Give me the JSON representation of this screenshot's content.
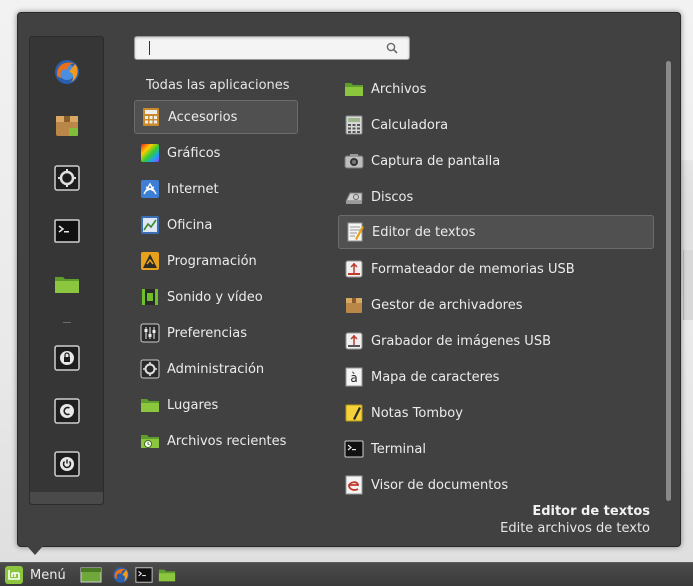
{
  "search": {
    "value": "",
    "placeholder": ""
  },
  "categories_header": "Todas las aplicaciones",
  "categories": [
    {
      "label": "Accesorios",
      "icon": "accessories-icon",
      "active": true
    },
    {
      "label": "Gráficos",
      "icon": "graphics-icon"
    },
    {
      "label": "Internet",
      "icon": "internet-icon"
    },
    {
      "label": "Oficina",
      "icon": "office-icon"
    },
    {
      "label": "Programación",
      "icon": "programming-icon"
    },
    {
      "label": "Sonido y vídeo",
      "icon": "multimedia-icon"
    },
    {
      "label": "Preferencias",
      "icon": "preferences-icon"
    },
    {
      "label": "Administración",
      "icon": "administration-icon"
    },
    {
      "label": "Lugares",
      "icon": "places-folder-icon"
    },
    {
      "label": "Archivos recientes",
      "icon": "recent-files-icon"
    }
  ],
  "apps": [
    {
      "label": "Archivos",
      "icon": "folder-icon"
    },
    {
      "label": "Calculadora",
      "icon": "calculator-icon"
    },
    {
      "label": "Captura de pantalla",
      "icon": "camera-icon"
    },
    {
      "label": "Discos",
      "icon": "disks-icon"
    },
    {
      "label": "Editor de textos",
      "icon": "text-editor-icon",
      "active": true
    },
    {
      "label": "Formateador de memorias USB",
      "icon": "usb-formatter-icon"
    },
    {
      "label": "Gestor de archivadores",
      "icon": "archive-manager-icon"
    },
    {
      "label": "Grabador de imágenes USB",
      "icon": "usb-writer-icon"
    },
    {
      "label": "Mapa de caracteres",
      "icon": "character-map-icon"
    },
    {
      "label": "Notas Tomboy",
      "icon": "tomboy-notes-icon"
    },
    {
      "label": "Terminal",
      "icon": "terminal-icon"
    },
    {
      "label": "Visor de documentos",
      "icon": "document-viewer-icon"
    }
  ],
  "description": {
    "title": "Editor de textos",
    "subtitle": "Edite archivos de texto"
  },
  "favorites": [
    {
      "icon": "firefox-icon"
    },
    {
      "icon": "software-manager-icon"
    },
    {
      "icon": "system-settings-icon"
    },
    {
      "icon": "terminal-icon"
    },
    {
      "icon": "folder-icon"
    },
    {
      "icon": "lock-screen-icon"
    },
    {
      "icon": "logout-icon"
    },
    {
      "icon": "shutdown-icon"
    }
  ],
  "taskbar": {
    "menu_label": "Menú",
    "launchers": [
      "show-desktop-icon",
      "firefox-icon",
      "terminal-icon",
      "folder-icon"
    ]
  },
  "colors": {
    "panel": "#414141",
    "highlight": "#505050",
    "mint_green": "#8cc63e"
  }
}
